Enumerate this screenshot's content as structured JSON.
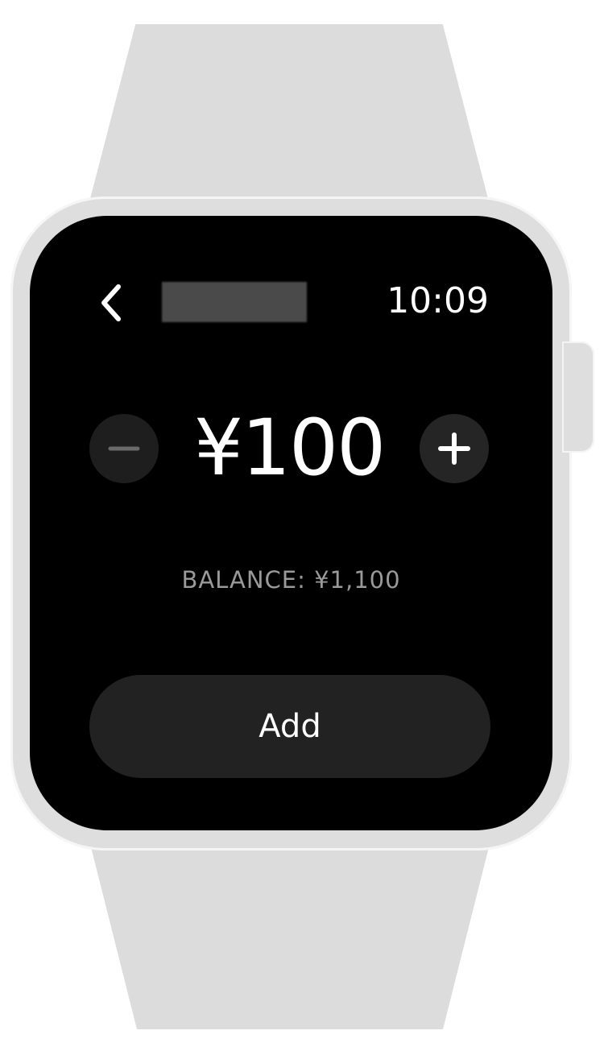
{
  "status_bar": {
    "back_icon": "chevron-left-icon",
    "title": "",
    "time": "10:09"
  },
  "amount_picker": {
    "decrement_icon": "minus-icon",
    "increment_icon": "plus-icon",
    "amount": "¥100"
  },
  "balance": {
    "text": "BALANCE: ¥1,100"
  },
  "actions": {
    "add_label": "Add"
  },
  "colors": {
    "screen_background": "#000000",
    "button_background": "#222222",
    "balance_text": "#9a9a9a",
    "device_body": "#dedede"
  }
}
